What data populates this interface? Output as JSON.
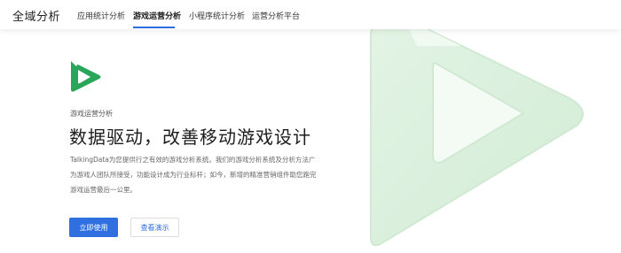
{
  "header": {
    "brand": "全域分析",
    "nav": [
      {
        "label": "应用统计分析"
      },
      {
        "label": "游戏运营分析"
      },
      {
        "label": "小程序统计分析"
      },
      {
        "label": "运营分析平台"
      }
    ],
    "active_index": 1
  },
  "hero": {
    "eyebrow": "游戏运营分析",
    "headline": "数据驱动，改善移动游戏设计",
    "description_lines": [
      "TalkingData为您提供行之有效的游戏分析系统。我们的游戏分析系统及分析方法广",
      "为游戏人团队所接受，功能设计成为行业标杆；如今，新增的精准营销组件助您跑完",
      "游戏运营最后一公里。"
    ],
    "primary_button": "立即使用",
    "secondary_button": "查看演示",
    "logo_icon": "game-analytics-logo-icon"
  },
  "colors": {
    "accent": "#2f6fdf",
    "brand_green": "#2aa65a",
    "watermark_green": "#d6efd9"
  }
}
